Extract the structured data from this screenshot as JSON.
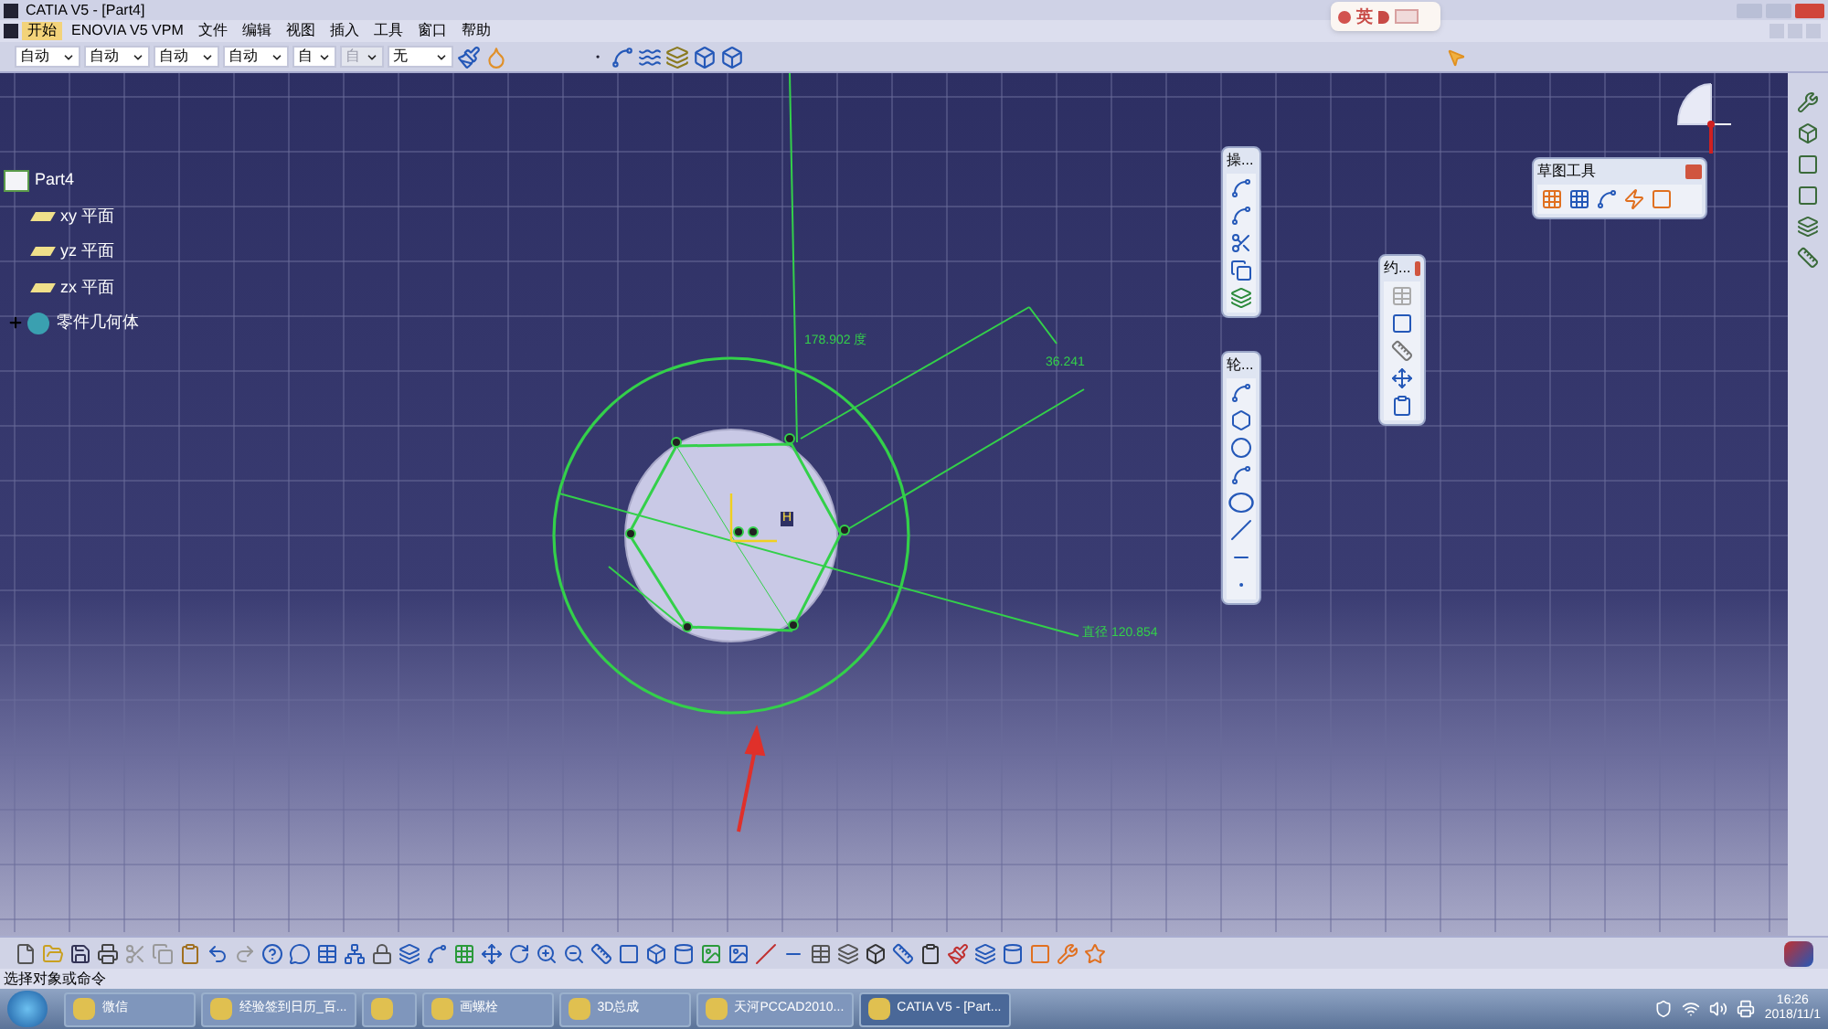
{
  "window": {
    "title": "CATIA V5 - [Part4]"
  },
  "menu": [
    {
      "label": "开始",
      "selected": true
    },
    {
      "label": "ENOVIA V5 VPM",
      "selected": false
    },
    {
      "label": "文件",
      "selected": false
    },
    {
      "label": "编辑",
      "selected": false
    },
    {
      "label": "视图",
      "selected": false
    },
    {
      "label": "插入",
      "selected": false
    },
    {
      "label": "工具",
      "selected": false
    },
    {
      "label": "窗口",
      "selected": false
    },
    {
      "label": "帮助",
      "selected": false
    }
  ],
  "style_dropdowns": [
    {
      "value": "自动",
      "disabled": false
    },
    {
      "value": "自动",
      "disabled": false
    },
    {
      "value": "自动",
      "disabled": false
    },
    {
      "value": "自动",
      "disabled": false
    },
    {
      "value": "自",
      "disabled": false
    },
    {
      "value": "自",
      "disabled": true
    },
    {
      "value": "无",
      "disabled": false
    }
  ],
  "ime_bar": {
    "language": "英"
  },
  "tree": {
    "label": "Part4",
    "expanded": true,
    "children": [
      {
        "label": "xy 平面",
        "kind": "plane"
      },
      {
        "label": "yz 平面",
        "kind": "plane"
      },
      {
        "label": "zx 平面",
        "kind": "plane"
      },
      {
        "label": "零件几何体",
        "kind": "body",
        "expanded": false
      }
    ]
  },
  "floating_toolbars": [
    {
      "title": "操..."
    },
    {
      "title": "轮..."
    },
    {
      "title": "约..."
    },
    {
      "title": "草图工具"
    }
  ],
  "sketch": {
    "angle_dimension": "178.902 度",
    "length_dimension": "36.241",
    "diameter_dimension": "直径 120.854",
    "h_axis": "H"
  },
  "status_bar": {
    "message": "选择对象或命令"
  },
  "taskbar": {
    "items": [
      {
        "label": "微信",
        "selected": false
      },
      {
        "label": "经验签到日历_百...",
        "selected": false
      },
      {
        "selected": false
      },
      {
        "label": "画螺栓",
        "selected": false
      },
      {
        "label": "3D总成",
        "selected": false
      },
      {
        "label": "天河PCCAD2010...",
        "selected": false
      },
      {
        "label": "CATIA V5 - [Part...",
        "selected": true
      }
    ],
    "time": "16:26",
    "date": "2018/11/1"
  }
}
